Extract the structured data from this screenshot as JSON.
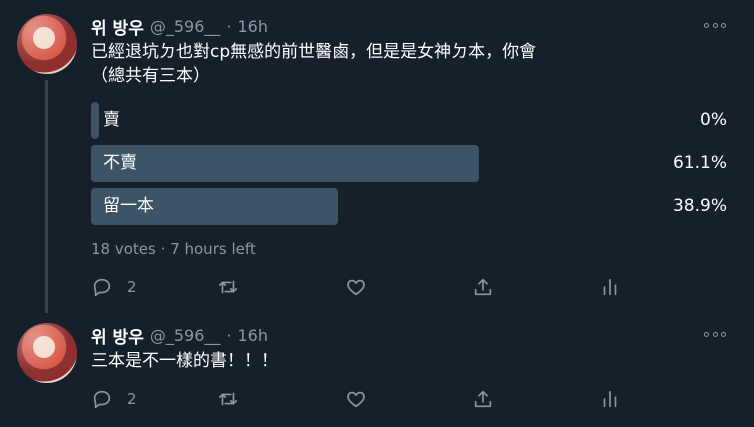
{
  "tweets": [
    {
      "author": "위 방우",
      "handle": "@_596__",
      "separator": "·",
      "time": "16h",
      "text_line1": "已經退坑ㄉ也對cp無感的前世醫鹵，但是是女神ㄉ本，你會",
      "text_line2": "（總共有三本）",
      "poll": {
        "options": [
          {
            "label": "賣",
            "percent": "0%",
            "fraction": 0.0
          },
          {
            "label": "不賣",
            "percent": "61.1%",
            "fraction": 0.611
          },
          {
            "label": "留一本",
            "percent": "38.9%",
            "fraction": 0.389
          }
        ],
        "votes": "18 votes",
        "separator": "·",
        "time_left": "7 hours left"
      },
      "actions": {
        "reply_count": "2",
        "retweet_count": "",
        "like_count": ""
      }
    },
    {
      "author": "위 방우",
      "handle": "@_596__",
      "separator": "·",
      "time": "16h",
      "text_line1": "三本是不一樣的書！！！",
      "actions": {
        "reply_count": "2",
        "retweet_count": "",
        "like_count": ""
      }
    }
  ],
  "colors": {
    "background": "#15202b",
    "poll_bar": "#3d5466",
    "muted_text": "#8899a6",
    "thread_line": "#38444d"
  },
  "icons": [
    "reply-icon",
    "retweet-icon",
    "like-icon",
    "share-icon",
    "analytics-icon",
    "more-icon"
  ]
}
